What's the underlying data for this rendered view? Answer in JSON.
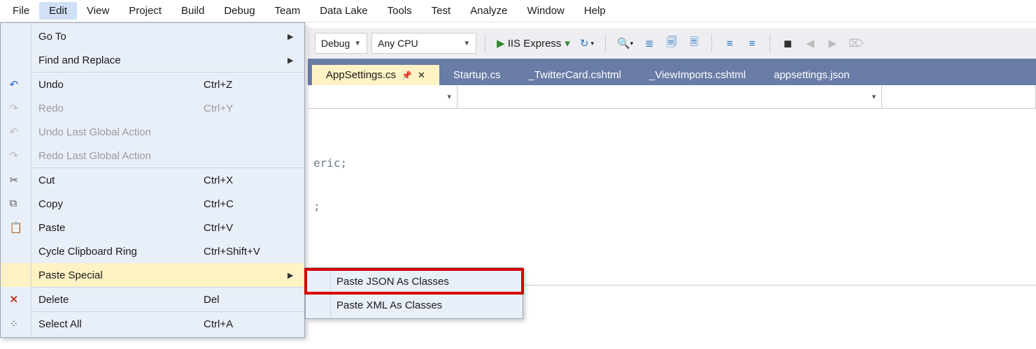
{
  "menubar": {
    "items": [
      "File",
      "Edit",
      "View",
      "Project",
      "Build",
      "Debug",
      "Team",
      "Data Lake",
      "Tools",
      "Test",
      "Analyze",
      "Window",
      "Help"
    ],
    "active_index": 1
  },
  "toolbar": {
    "config_label": "Debug",
    "platform_label": "Any CPU",
    "run_label": "IIS Express"
  },
  "tabs": [
    {
      "label": "AppSettings.cs",
      "active": true,
      "pinned": true
    },
    {
      "label": "Startup.cs",
      "active": false
    },
    {
      "label": "_TwitterCard.cshtml",
      "active": false
    },
    {
      "label": "_ViewImports.cshtml",
      "active": false
    },
    {
      "label": "appsettings.json",
      "active": false
    }
  ],
  "editor": {
    "line1": "eric;",
    "line2": ";"
  },
  "edit_menu": {
    "items": [
      {
        "icon": "",
        "label": "Go To",
        "shortcut": "",
        "arrow": true,
        "disabled": false
      },
      {
        "icon": "",
        "label": "Find and Replace",
        "shortcut": "",
        "arrow": true,
        "disabled": false
      },
      {
        "sep": true
      },
      {
        "icon": "undo",
        "label": "Undo",
        "shortcut": "Ctrl+Z",
        "arrow": false,
        "disabled": false
      },
      {
        "icon": "redo",
        "label": "Redo",
        "shortcut": "Ctrl+Y",
        "arrow": false,
        "disabled": true
      },
      {
        "icon": "undo2",
        "label": "Undo Last Global Action",
        "shortcut": "",
        "arrow": false,
        "disabled": true
      },
      {
        "icon": "redo2",
        "label": "Redo Last Global Action",
        "shortcut": "",
        "arrow": false,
        "disabled": true
      },
      {
        "sep": true
      },
      {
        "icon": "cut",
        "label": "Cut",
        "shortcut": "Ctrl+X",
        "arrow": false,
        "disabled": false
      },
      {
        "icon": "copy",
        "label": "Copy",
        "shortcut": "Ctrl+C",
        "arrow": false,
        "disabled": false
      },
      {
        "icon": "paste",
        "label": "Paste",
        "shortcut": "Ctrl+V",
        "arrow": false,
        "disabled": false
      },
      {
        "icon": "",
        "label": "Cycle Clipboard Ring",
        "shortcut": "Ctrl+Shift+V",
        "arrow": false,
        "disabled": false
      },
      {
        "icon": "",
        "label": "Paste Special",
        "shortcut": "",
        "arrow": true,
        "disabled": false,
        "hover": true
      },
      {
        "sep": true
      },
      {
        "icon": "delete",
        "label": "Delete",
        "shortcut": "Del",
        "arrow": false,
        "disabled": false
      },
      {
        "sep": true
      },
      {
        "icon": "select",
        "label": "Select All",
        "shortcut": "Ctrl+A",
        "arrow": false,
        "disabled": false
      }
    ]
  },
  "paste_special_submenu": {
    "items": [
      {
        "label": "Paste JSON As Classes",
        "highlight": true
      },
      {
        "label": "Paste XML As Classes",
        "highlight": false
      }
    ]
  }
}
